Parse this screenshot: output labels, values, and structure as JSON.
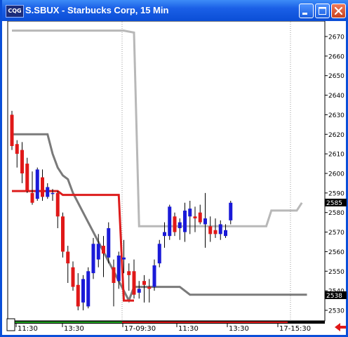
{
  "window": {
    "title": "S.SBUX - Starbucks Corp, 15 Min",
    "app_icon_text": "CQG",
    "buttons": [
      "minimize-icon",
      "maximize-icon",
      "close-icon"
    ]
  },
  "colors": {
    "up_candle": "#1a1ad8",
    "down_candle": "#e01818",
    "upper_channel": "#b8b8b8",
    "lower_channel": "#7a7a7a",
    "trailing_stop": "#dd1c1c",
    "grid": "#999999"
  },
  "price_axis": {
    "ticks": [
      "2670",
      "2660",
      "2650",
      "2640",
      "2630",
      "2620",
      "2610",
      "2600",
      "2590",
      "2580",
      "2570",
      "2560",
      "2550",
      "2540",
      "2530"
    ],
    "current_price_label": "2585",
    "channel_low_label": "2538"
  },
  "time_axis": {
    "labels": [
      "11:30",
      "13:30",
      "17-09:30",
      "11:30",
      "13:30",
      "17-15:30"
    ]
  },
  "chart_data": {
    "type": "candlestick",
    "ylim": [
      2527,
      2677
    ],
    "candles": [
      [
        2630,
        2632,
        2612,
        2614
      ],
      [
        2615,
        2617,
        2603,
        2610
      ],
      [
        2612,
        2616,
        2595,
        2600
      ],
      [
        2605,
        2608,
        2590,
        2591
      ],
      [
        2590,
        2601,
        2584,
        2585
      ],
      [
        2587,
        2603,
        2586,
        2602
      ],
      [
        2598,
        2602,
        2586,
        2588
      ],
      [
        2588,
        2595,
        2587,
        2593
      ],
      [
        2590,
        2592,
        2586,
        2590
      ],
      [
        2590,
        2591,
        2572,
        2578
      ],
      [
        2578,
        2580,
        2557,
        2560
      ],
      [
        2560,
        2563,
        2544,
        2554
      ],
      [
        2552,
        2555,
        2540,
        2542
      ],
      [
        2543,
        2549,
        2530,
        2532
      ],
      [
        2534,
        2548,
        2530,
        2546
      ],
      [
        2532,
        2552,
        2531,
        2550
      ],
      [
        2549,
        2567,
        2546,
        2564
      ],
      [
        2556,
        2569,
        2552,
        2564
      ],
      [
        2563,
        2568,
        2547,
        2559
      ],
      [
        2557,
        2575,
        2554,
        2572
      ],
      [
        2552,
        2556,
        2532,
        2544
      ],
      [
        2545,
        2560,
        2541,
        2558
      ],
      [
        2556,
        2566,
        2549,
        2557
      ],
      [
        2550,
        2554,
        2540,
        2548
      ],
      [
        2550,
        2556,
        2536,
        2538
      ],
      [
        2539,
        2545,
        2536,
        2541
      ],
      [
        2545,
        2548,
        2534,
        2543
      ],
      [
        2542,
        2546,
        2534,
        2541
      ],
      [
        2542,
        2556,
        2540,
        2553
      ],
      [
        2554,
        2566,
        2552,
        2564
      ],
      [
        2568,
        2575,
        2562,
        2570
      ],
      [
        2568,
        2584,
        2566,
        2583
      ],
      [
        2578,
        2580,
        2568,
        2570
      ],
      [
        2572,
        2577,
        2566,
        2575
      ],
      [
        2570,
        2585,
        2565,
        2581
      ],
      [
        2578,
        2586,
        2569,
        2582
      ],
      [
        2578,
        2583,
        2570,
        2577
      ],
      [
        2580,
        2584,
        2574,
        2575
      ],
      [
        2574,
        2590,
        2562,
        2577
      ],
      [
        2573,
        2578,
        2565,
        2569
      ],
      [
        2571,
        2577,
        2567,
        2569
      ],
      [
        2569,
        2576,
        2566,
        2574
      ],
      [
        2568,
        2574,
        2567,
        2571
      ],
      [
        2576,
        2586,
        2574,
        2585
      ]
    ],
    "upper_channel": [
      [
        0,
        2673
      ],
      [
        22,
        2673
      ],
      [
        24,
        2672
      ],
      [
        25,
        2573
      ],
      [
        50,
        2573
      ],
      [
        51,
        2581
      ],
      [
        56,
        2581
      ],
      [
        57,
        2585
      ]
    ],
    "lower_channel": [
      [
        0,
        2620
      ],
      [
        7,
        2620
      ],
      [
        8,
        2610
      ],
      [
        9,
        2603
      ],
      [
        10,
        2599
      ],
      [
        11,
        2597
      ],
      [
        12,
        2590
      ],
      [
        23,
        2535
      ],
      [
        24,
        2542
      ],
      [
        33,
        2542
      ],
      [
        35,
        2538
      ],
      [
        58,
        2538
      ]
    ],
    "trailing_stop": [
      [
        0,
        2591
      ],
      [
        9,
        2591
      ],
      [
        10,
        2589
      ],
      [
        21,
        2589
      ],
      [
        22,
        2535
      ],
      [
        24,
        2535
      ]
    ]
  }
}
